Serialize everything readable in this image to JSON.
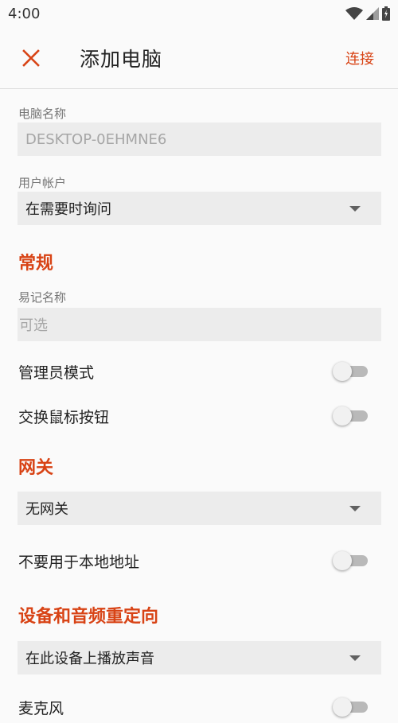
{
  "status_bar": {
    "time": "4:00"
  },
  "app_bar": {
    "title": "添加电脑",
    "action_label": "连接"
  },
  "pc_name": {
    "label": "电脑名称",
    "placeholder": "DESKTOP-0EHMNE6"
  },
  "user_account": {
    "label": "用户帐户",
    "selected": "在需要时询问"
  },
  "general": {
    "title": "常规",
    "friendly_name": {
      "label": "易记名称",
      "placeholder": "可选"
    },
    "admin_mode": {
      "label": "管理员模式",
      "on": false
    },
    "swap_mouse": {
      "label": "交换鼠标按钮",
      "on": false
    }
  },
  "gateway": {
    "title": "网关",
    "selected": "无网关",
    "bypass_local": {
      "label": "不要用于本地地址",
      "on": false
    }
  },
  "device_audio": {
    "title": "设备和音频重定向",
    "selected": "在此设备上播放声音",
    "microphone": {
      "label": "麦克风",
      "on": false
    }
  },
  "colors": {
    "accent": "#d84315",
    "field_bg": "#ececec",
    "background": "#fafafa"
  }
}
